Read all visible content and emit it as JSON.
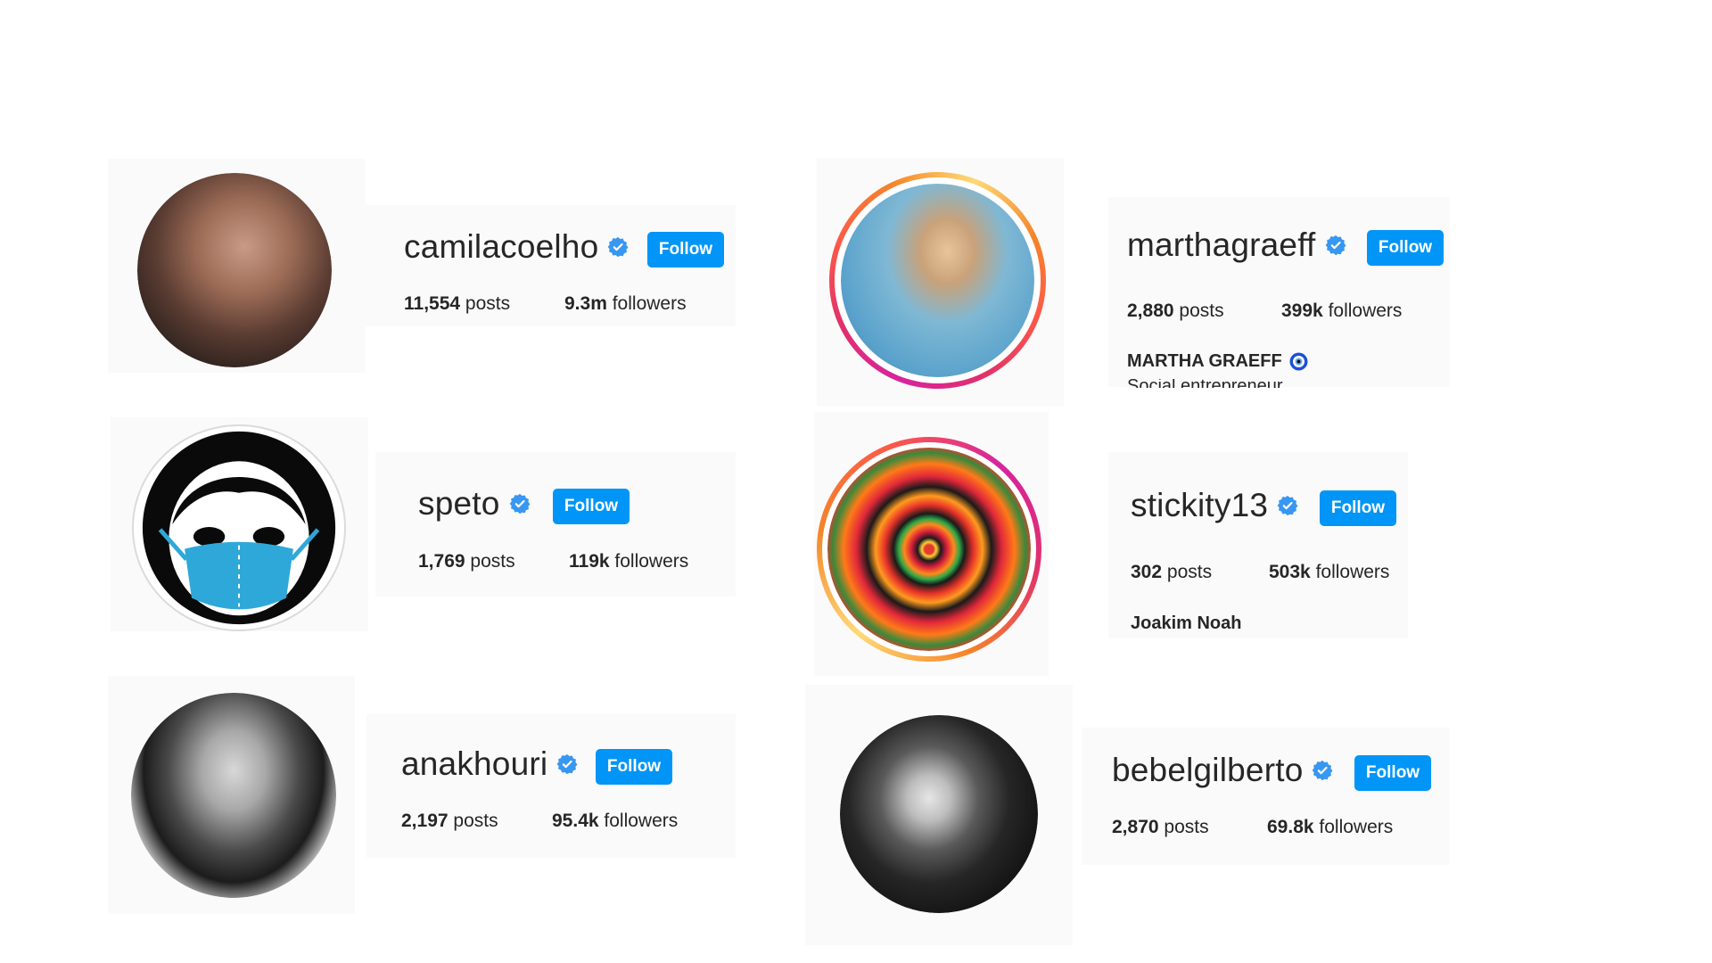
{
  "profiles": [
    {
      "username": "camilacoelho",
      "follow_label": "Follow",
      "posts_count": "11,554",
      "posts_label": "posts",
      "followers_count": "9.3m",
      "followers_label": "followers",
      "verified": true
    },
    {
      "username": "marthagraeff",
      "follow_label": "Follow",
      "posts_count": "2,880",
      "posts_label": "posts",
      "followers_count": "399k",
      "followers_label": "followers",
      "full_name": "MARTHA GRAEFF",
      "bio": "Social entrepreneur",
      "verified": true
    },
    {
      "username": "speto",
      "follow_label": "Follow",
      "posts_count": "1,769",
      "posts_label": "posts",
      "followers_count": "119k",
      "followers_label": "followers",
      "verified": true
    },
    {
      "username": "stickity13",
      "follow_label": "Follow",
      "posts_count": "302",
      "posts_label": "posts",
      "followers_count": "503k",
      "followers_label": "followers",
      "full_name": "Joakim Noah",
      "verified": true
    },
    {
      "username": "anakhouri",
      "follow_label": "Follow",
      "posts_count": "2,197",
      "posts_label": "posts",
      "followers_count": "95.4k",
      "followers_label": "followers",
      "verified": true
    },
    {
      "username": "bebelgilberto",
      "follow_label": "Follow",
      "posts_count": "2,870",
      "posts_label": "posts",
      "followers_count": "69.8k",
      "followers_label": "followers",
      "verified": true
    }
  ],
  "colors": {
    "follow_button": "#0095f6",
    "verified_badge": "#3897f0",
    "card_background": "#fafafa",
    "text": "#262626"
  },
  "icons": {
    "verified": "verified-badge-icon",
    "evil_eye": "nazar-eye-icon"
  }
}
